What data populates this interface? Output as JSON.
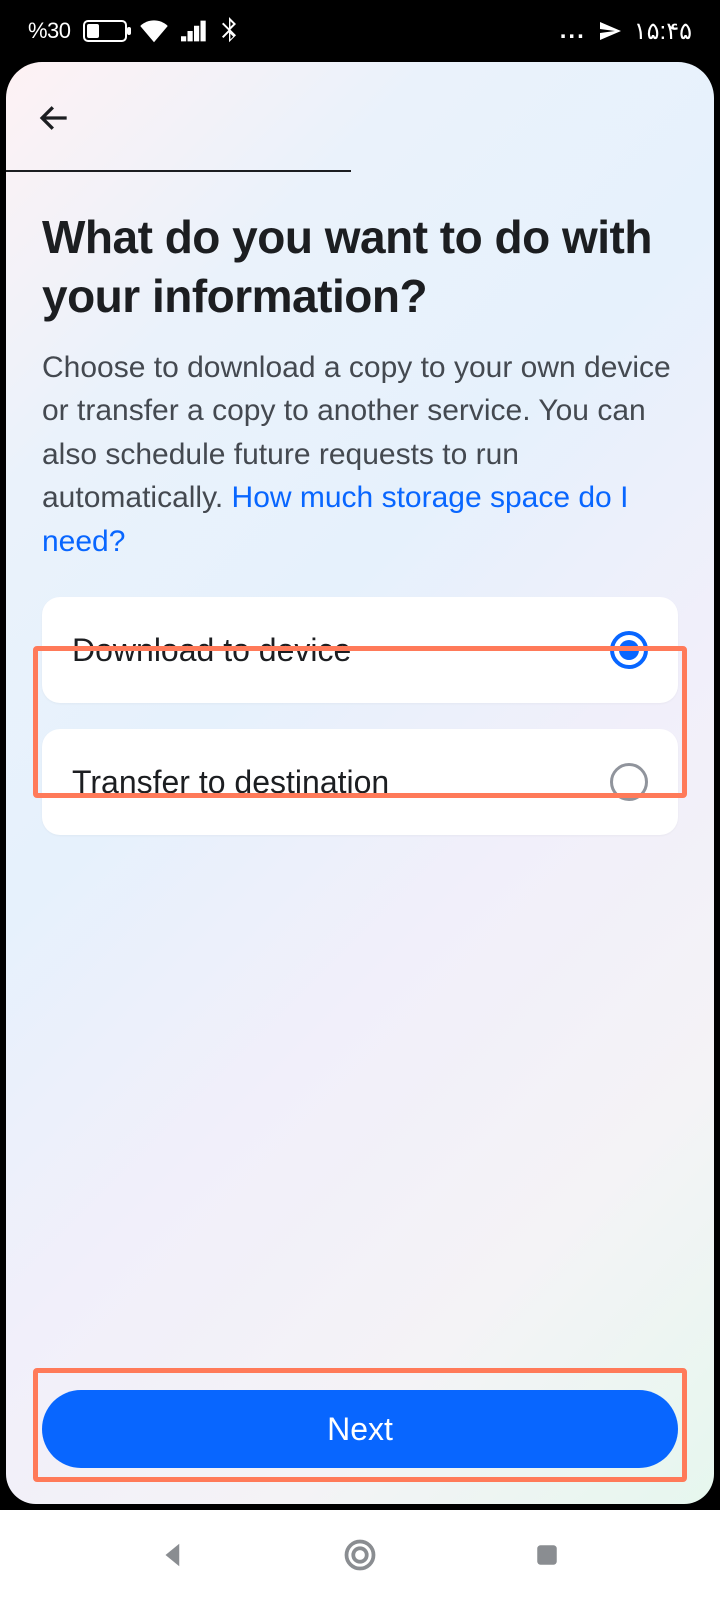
{
  "status": {
    "battery_pct": "%30",
    "clock": "۱۵:۴۵",
    "more": "..."
  },
  "page": {
    "title": "What do you want to do with your information?",
    "description": "Choose to download a copy to your own device or transfer a copy to another service. You can also schedule future requests to run automatically. ",
    "link": "How much storage space do I need?"
  },
  "options": [
    {
      "label": "Download to device",
      "selected": true
    },
    {
      "label": "Transfer to destination",
      "selected": false
    }
  ],
  "actions": {
    "next": "Next"
  }
}
